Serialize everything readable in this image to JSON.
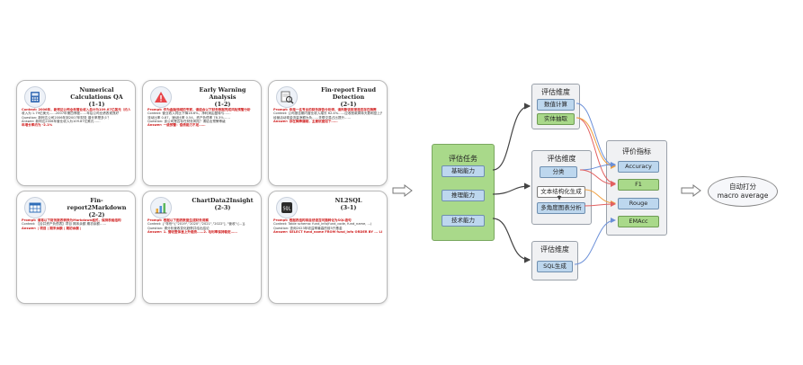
{
  "cards": [
    {
      "title": "Numerical Calculations QA",
      "code": "(1-1)",
      "lines": [
        "Context: 2006年，新柯达公司全年营业收入总计为109.87亿美元（约人民币1,373亿元），2006年第一季度净",
        "收入为 1.79亿美元……2007年第四季度……年后公司业绩表现良好",
        "Question: 新柯达公司2006年到2007年财务 增长率是多少？",
        "Answer: 新柯达2006年营业收入为109.87亿美元……",
        "年增长率约为 -2.1%"
      ]
    },
    {
      "title": "Early Warning Analysis",
      "code": "(1-2)",
      "lines": [
        "Prompt: 作为金融领域的专家，请结合以下财务数据完成风险预警分析",
        "Context: 营业收入同比下降18.6%，净利润由盈转亏……",
        "流动比率 0.87，速动比率 0.54，资产负债率 78.3%……",
        "Question: 该公司是否存在财务风险？请给出预警等级",
        "Answer: 一级预警：偿债能力不足……"
      ]
    },
    {
      "title": "Fin-report Fraud Detection",
      "code": "(2-1)",
      "lines": [
        "Prompt: 你是一名专业的财务报告分析师，请判断该财报是否存在舞弊",
        "Context: 公司报告期内营业收入增长 62.4%……应收账款周转天数明显上升……",
        "经营活动现金流量净额为负……关联交易占比提升……",
        "Answer: 存在舞弊嫌疑，主要依据如下……"
      ]
    },
    {
      "title": "Fin-report2Markdown",
      "code": "(2-2)",
      "lines": [
        "Prompt: 请将以下财务报表转换为Markdown格式，保持表格结构",
        "Context: 【合并资产负债表】项目 期末余额 期初余额……",
        "Answer: | 项目 | 期末余额 | 期初余额 |"
      ]
    },
    {
      "title": "ChartData2Insight",
      "code": "(2-3)",
      "lines": [
        "Prompt: 根据以下图表数据生成财务洞察",
        "Context: {\"年份\":[\"2019\",\"2020\",\"2021\",\"2022\"], \"营收\":[...]}",
        "Question: 请分析营收变化趋势并给出结论",
        "Answer: 1. 营收整体呈上升趋势……2. 毛利率保持稳定……"
      ]
    },
    {
      "title": "NL2SQL",
      "code": "(3-1)",
      "lines": [
        "Prompt: 根据表结构将自然语言问题转化为SQL语句",
        "Context: Table schema: fund_info(fund_code, fund_name, ...)",
        "Question: 查询2023年收益率最高的前5只基金",
        "Answer: SELECT fund_name FROM fund_info ORDER BY ... LIMIT 5;"
      ]
    }
  ],
  "task_panel": {
    "title": "评估任务",
    "items": [
      "基础能力",
      "推理能力",
      "技术能力"
    ]
  },
  "dim_panels": [
    {
      "title": "评估维度",
      "items": [
        "数值计算",
        "实体抽取"
      ]
    },
    {
      "title": "评估维度",
      "items": [
        "分类",
        "文本结构化生成",
        "多角度图表分析"
      ]
    },
    {
      "title": "评估维度",
      "items": [
        "SQL生成"
      ]
    }
  ],
  "metric_panel": {
    "title": "评价指标",
    "items": [
      "Accuracy",
      "F1",
      "Rouge",
      "EMAcc"
    ]
  },
  "final": {
    "line1": "自动打分",
    "line2": "macro average"
  },
  "colors": {
    "green": "#a9d98a",
    "blue": "#bdd7ee",
    "panel": "#f0f1f3",
    "line_red": "#e26060",
    "line_blue": "#6a8fd8",
    "line_orange": "#f0a040",
    "line_black": "#444444"
  }
}
